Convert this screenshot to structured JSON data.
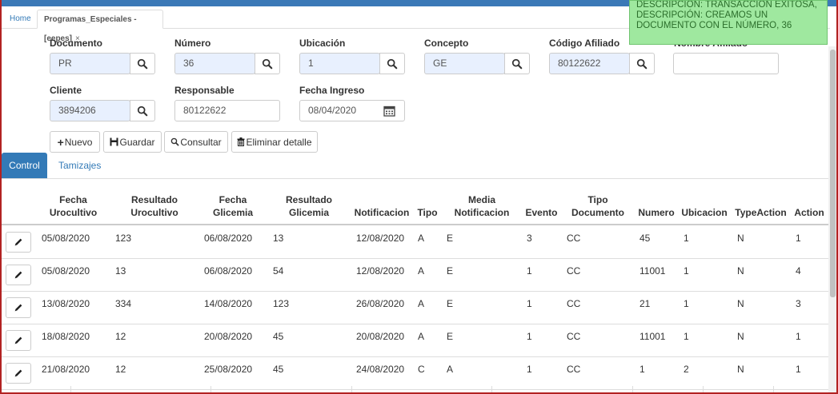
{
  "tabs": {
    "home": "Home",
    "active": "Programas_Especiales -[eepes]",
    "close": "×"
  },
  "toast": {
    "line1": "DESCRIPCIÓN: TRANSACCIÓN EXITOSA,",
    "line2": "DESCRIPCIÓN: CREAMOS UN",
    "line3": "DOCUMENTO CON EL NÚMERO, 36"
  },
  "form": {
    "documento": {
      "label": "Documento",
      "value": "PR"
    },
    "numero": {
      "label": "Número",
      "value": "36"
    },
    "ubicacion": {
      "label": "Ubicación",
      "value": "1"
    },
    "concepto": {
      "label": "Concepto",
      "value": "GE"
    },
    "codigo_afiliado": {
      "label": "Código Afiliado",
      "value": "80122622"
    },
    "nombre_afiliado": {
      "label": "Nombre Afiliado",
      "value": ""
    },
    "cliente": {
      "label": "Cliente",
      "value": "3894206"
    },
    "responsable": {
      "label": "Responsable",
      "value": "80122622"
    },
    "fecha_ingreso": {
      "label": "Fecha Ingreso",
      "value": "08/04/2020"
    }
  },
  "actions": {
    "nuevo": "Nuevo",
    "guardar": "Guardar",
    "consultar": "Consultar",
    "eliminar": "Eliminar detalle"
  },
  "subtabs": {
    "control": "Control",
    "tamizajes": "Tamizajes"
  },
  "table": {
    "headers": {
      "fecha_urocultivo": [
        "Fecha",
        "Urocultivo"
      ],
      "resultado_urocultivo": [
        "Resultado",
        "Urocultivo"
      ],
      "fecha_glicemia": [
        "Fecha",
        "Glicemia"
      ],
      "resultado_glicemia": [
        "Resultado",
        "Glicemia"
      ],
      "notificacion": "Notificacion",
      "tipo": "Tipo",
      "media_notificacion": [
        "Media",
        "Notificacion"
      ],
      "evento": "Evento",
      "tipo_documento": [
        "Tipo",
        "Documento"
      ],
      "numero": "Numero",
      "ubicacion": "Ubicacion",
      "typeaction": "TypeAction",
      "action": "Action"
    },
    "rows": [
      [
        "05/08/2020",
        "123",
        "06/08/2020",
        "13",
        "12/08/2020",
        "A",
        "E",
        "3",
        "CC",
        "45",
        "1",
        "N",
        "1"
      ],
      [
        "05/08/2020",
        "13",
        "06/08/2020",
        "54",
        "12/08/2020",
        "A",
        "E",
        "1",
        "CC",
        "11001",
        "1",
        "N",
        "4"
      ],
      [
        "13/08/2020",
        "334",
        "14/08/2020",
        "123",
        "26/08/2020",
        "A",
        "E",
        "1",
        "CC",
        "21",
        "1",
        "N",
        "3"
      ],
      [
        "18/08/2020",
        "12",
        "20/08/2020",
        "45",
        "20/08/2020",
        "A",
        "E",
        "1",
        "CC",
        "11001",
        "1",
        "N",
        "1"
      ],
      [
        "21/08/2020",
        "12",
        "25/08/2020",
        "45",
        "24/08/2020",
        "C",
        "A",
        "1",
        "CC",
        "1",
        "2",
        "N",
        "1"
      ]
    ]
  }
}
